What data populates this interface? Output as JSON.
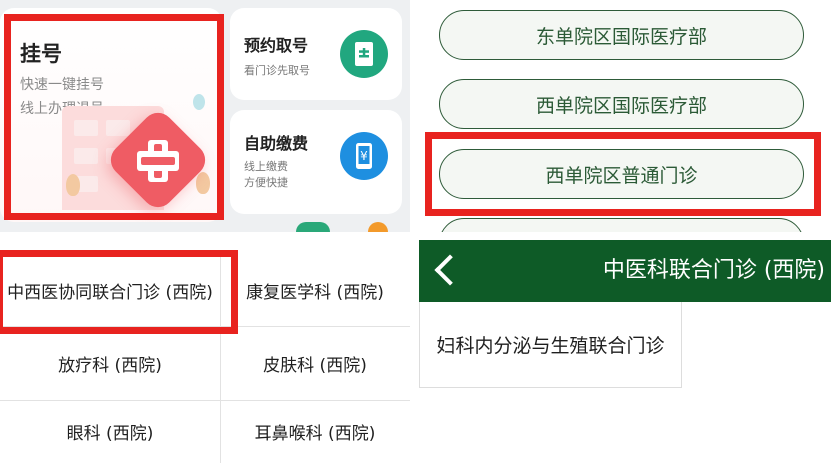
{
  "registration_panel": {
    "register_card": {
      "title": "挂号",
      "subtitle1": "快速一键挂号",
      "subtitle2": "线上办理退号"
    },
    "booking_card": {
      "title": "预约取号",
      "subtitle": "看门诊先取号"
    },
    "payment_card": {
      "title": "自助缴费",
      "subtitle1": "线上缴费",
      "subtitle2": "方便快捷"
    },
    "colors": {
      "register_accent": "#ef5c64",
      "booking_icon": "#21a77f",
      "payment_icon": "#1e8fe0",
      "highlight": "#e8231f"
    }
  },
  "hospital_list": {
    "items": [
      "东单院区国际医疗部",
      "西单院区国际医疗部",
      "西单院区普通门诊"
    ],
    "selected_index": 2,
    "colors": {
      "pill_text": "#2b5a36",
      "pill_border": "#2e5b39"
    }
  },
  "department_grid": {
    "cells": [
      "中西医协同联合门诊 (西院)",
      "康复医学科 (西院)",
      "放疗科 (西院)",
      "皮肤科 (西院)",
      "眼科 (西院)",
      "耳鼻喉科 (西院)"
    ],
    "selected_index": 0
  },
  "clinic_page": {
    "header_title": "中医科联合门诊 (西院)",
    "back_icon": "chevron-left-icon",
    "items": [
      "妇科内分泌与生殖联合门诊"
    ],
    "colors": {
      "header_bg": "#0e5b27"
    }
  }
}
